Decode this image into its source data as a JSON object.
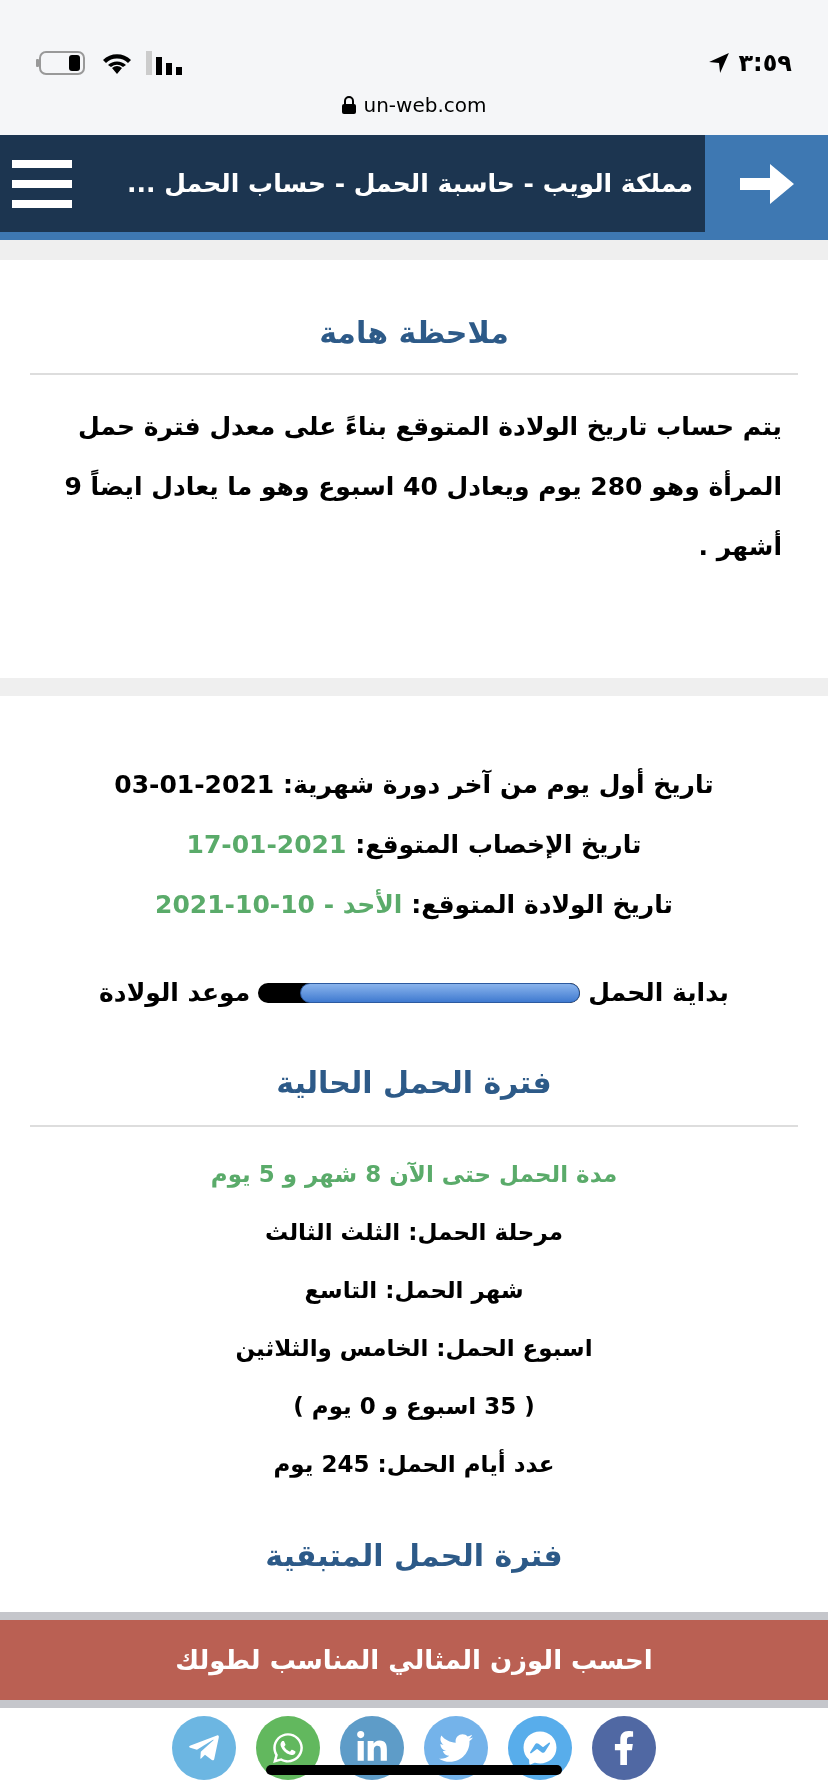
{
  "status_bar": {
    "time": "٣:٥٩"
  },
  "address_bar": {
    "url": "un-web.com"
  },
  "header": {
    "title": "مملكة الويب - حاسبة الحمل - حساب الحمل ..."
  },
  "note": {
    "title": "ملاحظة هامة",
    "text": "يتم حساب تاريخ الولادة المتوقع بناءً على معدل فترة حمل المرأة وهو 280 يوم ويعادل 40 اسبوع وهو ما يعادل ايضاً 9 أشهر ."
  },
  "dates": [
    {
      "label": "تاريخ أول يوم من آخر دورة شهرية:",
      "value": "03-01-2021",
      "highlight": false
    },
    {
      "label": "تاريخ الإخصاب المتوقع:",
      "value": "17-01-2021",
      "highlight": true
    },
    {
      "label": "تاريخ الولادة المتوقع:",
      "value": "الأحد - 10-10-2021",
      "highlight": true
    }
  ],
  "progress": {
    "start_label": "بداية الحمل",
    "end_label": "موعد الولادة",
    "level": 0.87
  },
  "current": {
    "title": "فترة الحمل الحالية",
    "duration": "مدة الحمل حتى الآن 8 شهر و 5 يوم",
    "details": [
      "مرحلة الحمل: الثلث الثالث",
      "شهر الحمل: التاسع",
      "اسبوع الحمل: الخامس والثلاثين",
      "( 35 اسبوع و 0 يوم )",
      "عدد أيام الحمل: 245 يوم"
    ]
  },
  "remaining": {
    "title": "فترة الحمل المتبقية"
  },
  "banner": {
    "label": "احسب الوزن المثالي المناسب لطولك"
  }
}
